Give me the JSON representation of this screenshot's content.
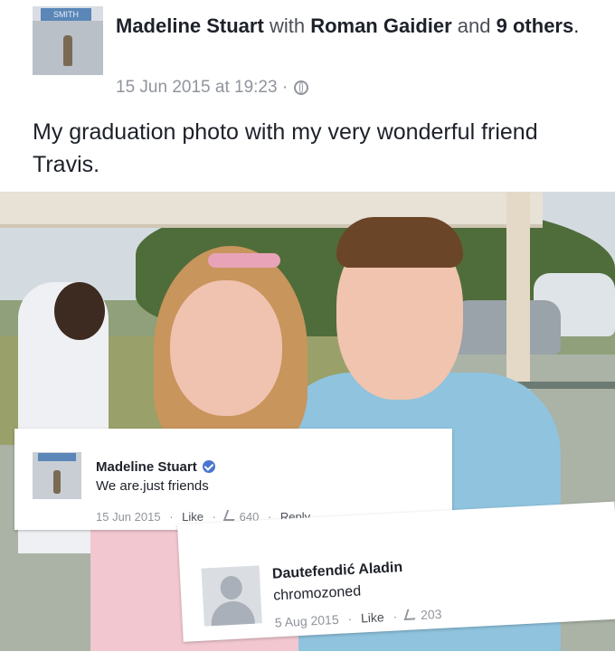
{
  "post": {
    "author": "Madeline Stuart",
    "with_word": "with",
    "tagged": "Roman Gaidier",
    "and_word": "and",
    "others": "9 others",
    "period": ".",
    "timestamp": "15 Jun 2015 at 19:23",
    "dot": "·",
    "caption": "My graduation photo with my very wonderful friend Travis.",
    "avatar_sign_text": "SMITH"
  },
  "comments": [
    {
      "name": "Madeline Stuart",
      "text": "We are.just friends",
      "date": "15 Jun 2015",
      "like_label": "Like",
      "likes": "640",
      "reply_label": "Reply",
      "verified": true
    },
    {
      "name": "Dautefendić Aladin",
      "text": "chromozoned",
      "date": "5 Aug 2015",
      "like_label": "Like",
      "likes": "203"
    }
  ],
  "sep": "·",
  "colors": {
    "name": "#1d2129",
    "meta": "#90949c",
    "verified": "#4a76d0"
  },
  "icons": [
    "globe-icon",
    "verified-badge-icon",
    "like-icon",
    "default-avatar-icon"
  ]
}
